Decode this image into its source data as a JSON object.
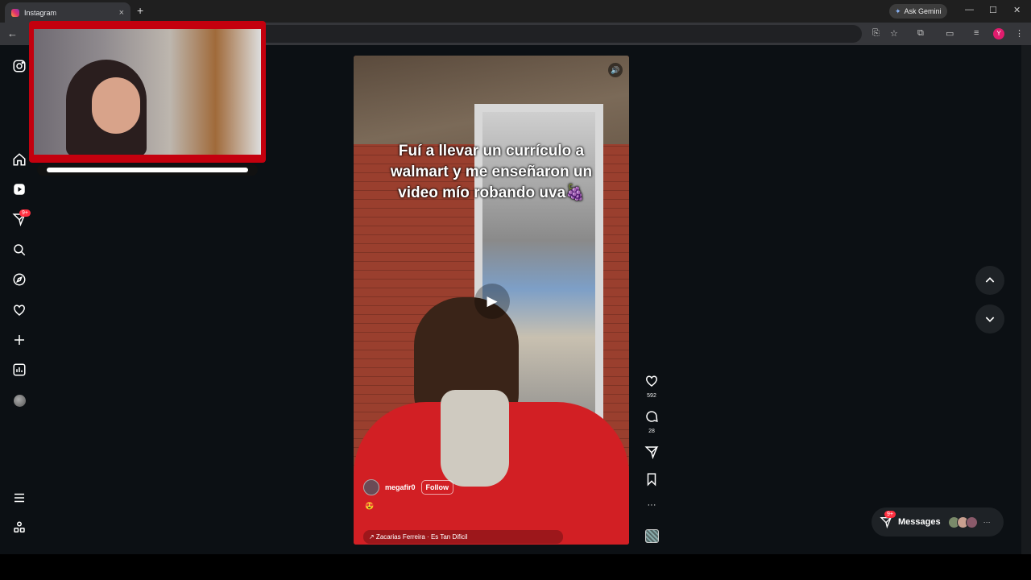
{
  "browser": {
    "tab_title": "Instagram",
    "tab_close": "×",
    "new_tab": "+",
    "ask_gemini": "Ask Gemini",
    "profile_initial": "Y"
  },
  "reel": {
    "caption_lines": [
      "Fuí a llevar un currículo a",
      "walmart y  me enseñaron un",
      "video mío robando uva🍇"
    ],
    "username": "megafir0",
    "follow_label": "Follow",
    "emoji_line": "😍",
    "music": "↗ Zacarias Ferreira · Es Tan Dificil"
  },
  "actions": {
    "likes": "592",
    "comments": "28",
    "more": "···"
  },
  "messages": {
    "label": "Messages",
    "badge": "9+",
    "more": "···"
  },
  "sidebar": {
    "notification_badge": "9+"
  },
  "colors": {
    "page_bg": "#0c1014",
    "badge": "#ff3040",
    "overlay_red": "#c4000e"
  }
}
